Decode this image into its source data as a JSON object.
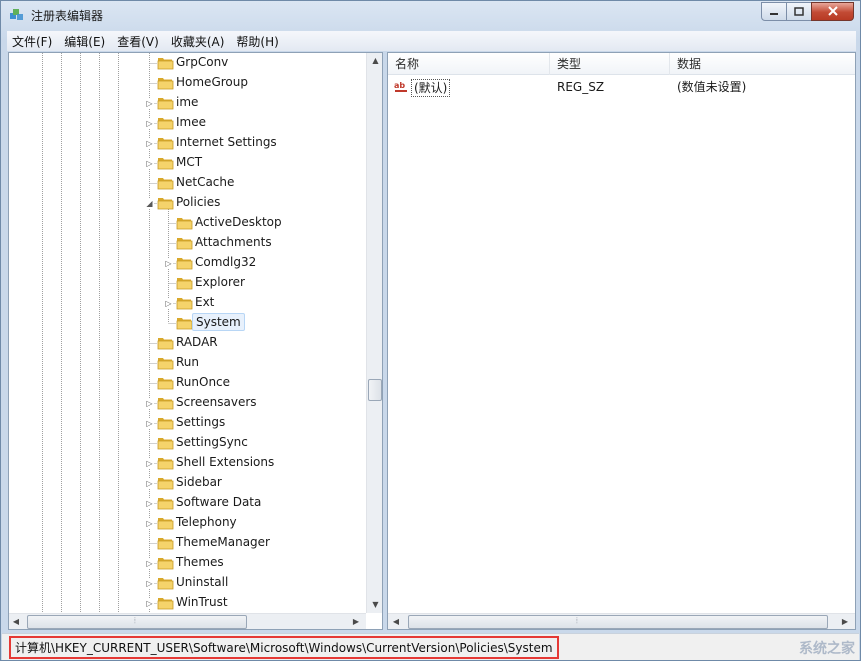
{
  "window": {
    "title": "注册表编辑器",
    "menu": [
      "文件(F)",
      "编辑(E)",
      "查看(V)",
      "收藏夹(A)",
      "帮助(H)"
    ]
  },
  "tree": {
    "items": [
      {
        "label": "GrpConv",
        "level": 0,
        "expander": ""
      },
      {
        "label": "HomeGroup",
        "level": 0,
        "expander": ""
      },
      {
        "label": "ime",
        "level": 0,
        "expander": "collapsed"
      },
      {
        "label": "Imee",
        "level": 0,
        "expander": "collapsed"
      },
      {
        "label": "Internet Settings",
        "level": 0,
        "expander": "collapsed"
      },
      {
        "label": "MCT",
        "level": 0,
        "expander": "collapsed"
      },
      {
        "label": "NetCache",
        "level": 0,
        "expander": ""
      },
      {
        "label": "Policies",
        "level": 0,
        "expander": "expanded"
      },
      {
        "label": "ActiveDesktop",
        "level": 1,
        "expander": ""
      },
      {
        "label": "Attachments",
        "level": 1,
        "expander": ""
      },
      {
        "label": "Comdlg32",
        "level": 1,
        "expander": "collapsed"
      },
      {
        "label": "Explorer",
        "level": 1,
        "expander": ""
      },
      {
        "label": "Ext",
        "level": 1,
        "expander": "collapsed"
      },
      {
        "label": "System",
        "level": 1,
        "expander": "",
        "selected": true
      },
      {
        "label": "RADAR",
        "level": 0,
        "expander": ""
      },
      {
        "label": "Run",
        "level": 0,
        "expander": ""
      },
      {
        "label": "RunOnce",
        "level": 0,
        "expander": ""
      },
      {
        "label": "Screensavers",
        "level": 0,
        "expander": "collapsed"
      },
      {
        "label": "Settings",
        "level": 0,
        "expander": "collapsed"
      },
      {
        "label": "SettingSync",
        "level": 0,
        "expander": ""
      },
      {
        "label": "Shell Extensions",
        "level": 0,
        "expander": "collapsed"
      },
      {
        "label": "Sidebar",
        "level": 0,
        "expander": "collapsed"
      },
      {
        "label": "Software Data",
        "level": 0,
        "expander": "collapsed"
      },
      {
        "label": "Telephony",
        "level": 0,
        "expander": "collapsed"
      },
      {
        "label": "ThemeManager",
        "level": 0,
        "expander": ""
      },
      {
        "label": "Themes",
        "level": 0,
        "expander": "collapsed"
      },
      {
        "label": "Uninstall",
        "level": 0,
        "expander": "collapsed"
      },
      {
        "label": "WinTrust",
        "level": 0,
        "expander": "collapsed"
      }
    ]
  },
  "list": {
    "columns": [
      "名称",
      "类型",
      "数据"
    ],
    "rows": [
      {
        "name": "(默认)",
        "type": "REG_SZ",
        "data": "(数值未设置)"
      }
    ]
  },
  "statusbar": {
    "path": "计算机\\HKEY_CURRENT_USER\\Software\\Microsoft\\Windows\\CurrentVersion\\Policies\\System",
    "watermark": "系统之家"
  },
  "colors": {
    "selection_border": "#b8d6f5",
    "status_highlight": "#e53935",
    "folder": "#e8c04a"
  }
}
